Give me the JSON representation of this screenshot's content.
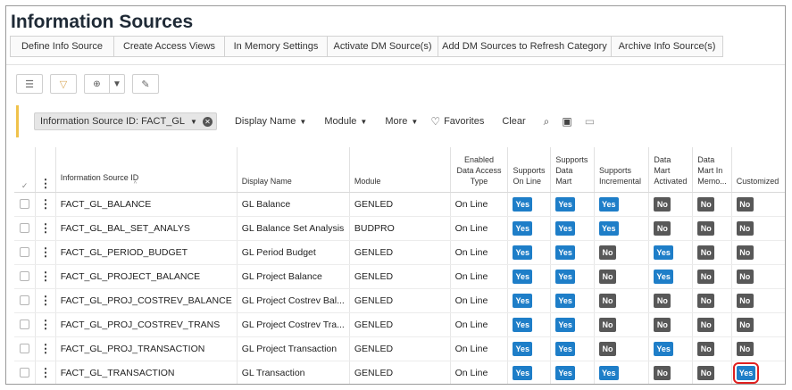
{
  "page_title": "Information Sources",
  "actions": [
    "Define Info Source",
    "Create Access Views",
    "In Memory Settings",
    "Activate DM Source(s)",
    "Add DM Sources to Refresh Category",
    "Archive Info Source(s)"
  ],
  "filter": {
    "chip_label": "Information Source ID: FACT_GL",
    "display_name": "Display Name",
    "module": "Module",
    "more": "More",
    "favorites": "Favorites",
    "clear": "Clear"
  },
  "table": {
    "headers": {
      "check": "✓",
      "kebab": "⋮",
      "info_source_id": "Information Source ID",
      "display_name": "Display Name",
      "module": "Module",
      "enabled_access": "Enabled Data Access Type",
      "supports_online": "Supports On Line",
      "supports_data_mart": "Supports Data Mart",
      "supports_incremental": "Supports Incremental",
      "dm_activated": "Data Mart Activated",
      "dm_in_memory": "Data Mart In Memo...",
      "customized": "Customized"
    },
    "rows": [
      {
        "id": "FACT_GL_BALANCE",
        "name": "GL Balance",
        "module": "GENLED",
        "access": "On Line",
        "online": "Yes",
        "datamart": "Yes",
        "incremental": "Yes",
        "activated": "No",
        "inmemory": "No",
        "customized": "No"
      },
      {
        "id": "FACT_GL_BAL_SET_ANALYS",
        "name": "GL Balance Set Analysis",
        "module": "BUDPRO",
        "access": "On Line",
        "online": "Yes",
        "datamart": "Yes",
        "incremental": "Yes",
        "activated": "No",
        "inmemory": "No",
        "customized": "No"
      },
      {
        "id": "FACT_GL_PERIOD_BUDGET",
        "name": "GL Period Budget",
        "module": "GENLED",
        "access": "On Line",
        "online": "Yes",
        "datamart": "Yes",
        "incremental": "No",
        "activated": "Yes",
        "inmemory": "No",
        "customized": "No"
      },
      {
        "id": "FACT_GL_PROJECT_BALANCE",
        "name": "GL Project Balance",
        "module": "GENLED",
        "access": "On Line",
        "online": "Yes",
        "datamart": "Yes",
        "incremental": "No",
        "activated": "Yes",
        "inmemory": "No",
        "customized": "No"
      },
      {
        "id": "FACT_GL_PROJ_COSTREV_BALANCE",
        "name": "GL Project Costrev Bal...",
        "module": "GENLED",
        "access": "On Line",
        "online": "Yes",
        "datamart": "Yes",
        "incremental": "No",
        "activated": "No",
        "inmemory": "No",
        "customized": "No"
      },
      {
        "id": "FACT_GL_PROJ_COSTREV_TRANS",
        "name": "GL Project Costrev Tra...",
        "module": "GENLED",
        "access": "On Line",
        "online": "Yes",
        "datamart": "Yes",
        "incremental": "No",
        "activated": "No",
        "inmemory": "No",
        "customized": "No"
      },
      {
        "id": "FACT_GL_PROJ_TRANSACTION",
        "name": "GL Project Transaction",
        "module": "GENLED",
        "access": "On Line",
        "online": "Yes",
        "datamart": "Yes",
        "incremental": "No",
        "activated": "Yes",
        "inmemory": "No",
        "customized": "No"
      },
      {
        "id": "FACT_GL_TRANSACTION",
        "name": "GL Transaction",
        "module": "GENLED",
        "access": "On Line",
        "online": "Yes",
        "datamart": "Yes",
        "incremental": "Yes",
        "activated": "No",
        "inmemory": "No",
        "customized": "Yes"
      }
    ]
  },
  "highlighted_cell": {
    "row": 7,
    "column": "customized"
  },
  "colors": {
    "yes": "#1e7ec8",
    "no": "#585858",
    "filter_accent": "#f0c24b",
    "highlight": "#e02020"
  },
  "icons": [
    "list-icon",
    "filter-icon",
    "group-icon",
    "edit-icon",
    "remove-filter-icon",
    "heart-icon",
    "search-icon",
    "save-icon",
    "folder-icon",
    "kebab-icon",
    "checkmark-icon",
    "sort-asc-icon"
  ]
}
